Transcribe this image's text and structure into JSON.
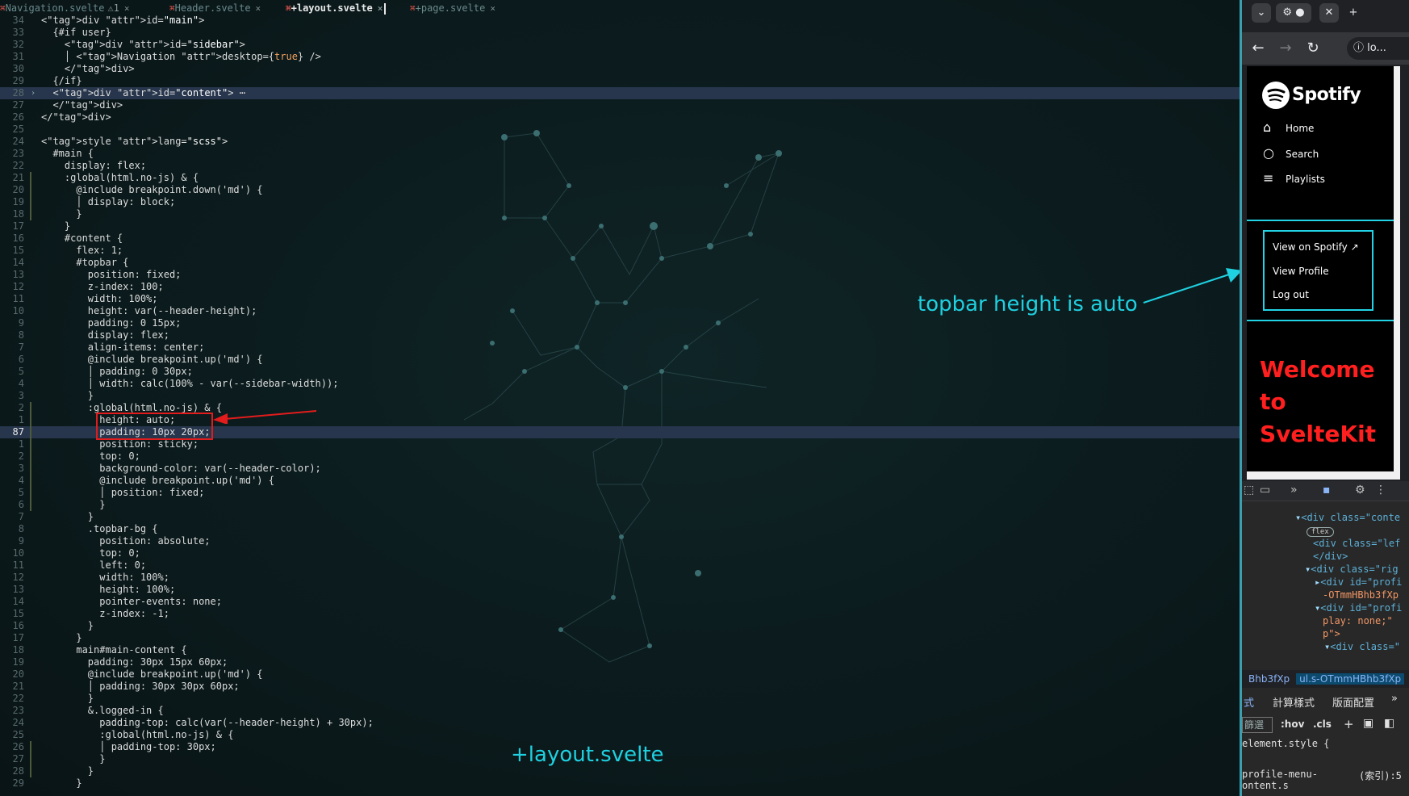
{
  "editor": {
    "tabs": [
      {
        "label": "Navigation.svelte",
        "warn": "⚠1",
        "close": "⨯"
      },
      {
        "label": "Header.svelte",
        "close": "⨯"
      },
      {
        "label": "+layout.svelte",
        "close": "⨯"
      },
      {
        "label": "+page.svelte",
        "close": "⨯"
      }
    ],
    "lines": [
      {
        "n": "34",
        "t": "<div id=\"main\">"
      },
      {
        "n": "33",
        "t": "  {#if user}"
      },
      {
        "n": "32",
        "t": "    <div id=\"sidebar\">"
      },
      {
        "n": "31",
        "t": "    │ <Navigation desktop={true} />"
      },
      {
        "n": "30",
        "t": "    </div>"
      },
      {
        "n": "29",
        "t": "  {/if}"
      },
      {
        "n": "28",
        "t": "  <div id=\"content\"> ⋯"
      },
      {
        "n": "27",
        "t": "  </div>"
      },
      {
        "n": "26",
        "t": "</div>"
      },
      {
        "n": "25",
        "t": ""
      },
      {
        "n": "24",
        "t": "<style lang=\"scss\">"
      },
      {
        "n": "23",
        "t": "  #main {"
      },
      {
        "n": "22",
        "t": "    display: flex;"
      },
      {
        "n": "21",
        "t": "    :global(html.no-js) & {"
      },
      {
        "n": "20",
        "t": "      @include breakpoint.down('md') {"
      },
      {
        "n": "19",
        "t": "      │ display: block;"
      },
      {
        "n": "18",
        "t": "      }"
      },
      {
        "n": "17",
        "t": "    }"
      },
      {
        "n": "16",
        "t": "    #content {"
      },
      {
        "n": "15",
        "t": "      flex: 1;"
      },
      {
        "n": "14",
        "t": "      #topbar {"
      },
      {
        "n": "13",
        "t": "        position: fixed;"
      },
      {
        "n": "12",
        "t": "        z-index: 100;"
      },
      {
        "n": "11",
        "t": "        width: 100%;"
      },
      {
        "n": "10",
        "t": "        height: var(--header-height);"
      },
      {
        "n": "9",
        "t": "        padding: 0 15px;"
      },
      {
        "n": "8",
        "t": "        display: flex;"
      },
      {
        "n": "7",
        "t": "        align-items: center;"
      },
      {
        "n": "6",
        "t": "        @include breakpoint.up('md') {"
      },
      {
        "n": "5",
        "t": "        │ padding: 0 30px;"
      },
      {
        "n": "4",
        "t": "        │ width: calc(100% - var(--sidebar-width));"
      },
      {
        "n": "3",
        "t": "        }"
      },
      {
        "n": "2",
        "t": "        :global(html.no-js) & {"
      },
      {
        "n": "1",
        "t": "          height: auto;"
      },
      {
        "n": "87",
        "t": "          padding: 10px 20px;"
      },
      {
        "n": "1",
        "t": "          position: sticky;"
      },
      {
        "n": "2",
        "t": "          top: 0;"
      },
      {
        "n": "3",
        "t": "          background-color: var(--header-color);"
      },
      {
        "n": "4",
        "t": "          @include breakpoint.up('md') {"
      },
      {
        "n": "5",
        "t": "          │ position: fixed;"
      },
      {
        "n": "6",
        "t": "          }"
      },
      {
        "n": "7",
        "t": "        }"
      },
      {
        "n": "8",
        "t": "        .topbar-bg {"
      },
      {
        "n": "9",
        "t": "          position: absolute;"
      },
      {
        "n": "10",
        "t": "          top: 0;"
      },
      {
        "n": "11",
        "t": "          left: 0;"
      },
      {
        "n": "12",
        "t": "          width: 100%;"
      },
      {
        "n": "13",
        "t": "          height: 100%;"
      },
      {
        "n": "14",
        "t": "          pointer-events: none;"
      },
      {
        "n": "15",
        "t": "          z-index: -1;"
      },
      {
        "n": "16",
        "t": "        }"
      },
      {
        "n": "17",
        "t": "      }"
      },
      {
        "n": "18",
        "t": "      main#main-content {"
      },
      {
        "n": "19",
        "t": "        padding: 30px 15px 60px;"
      },
      {
        "n": "20",
        "t": "        @include breakpoint.up('md') {"
      },
      {
        "n": "21",
        "t": "        │ padding: 30px 30px 60px;"
      },
      {
        "n": "22",
        "t": "        }"
      },
      {
        "n": "23",
        "t": "        &.logged-in {"
      },
      {
        "n": "24",
        "t": "          padding-top: calc(var(--header-height) + 30px);"
      },
      {
        "n": "25",
        "t": "          :global(html.no-js) & {"
      },
      {
        "n": "26",
        "t": "          │ padding-top: 30px;"
      },
      {
        "n": "27",
        "t": "          }"
      },
      {
        "n": "28",
        "t": "        }"
      },
      {
        "n": "29",
        "t": "      }"
      }
    ],
    "highlighted_line_indexes": [
      6,
      34
    ],
    "annotation_topbar": "topbar height is auto",
    "annotation_layout": "+layout.svelte"
  },
  "browser": {
    "url": "lo...",
    "page": {
      "logo": "Spotify",
      "nav": [
        {
          "label": "Home",
          "icon": "home-icon"
        },
        {
          "label": "Search",
          "icon": "search-icon"
        },
        {
          "label": "Playlists",
          "icon": "playlist-icon"
        }
      ],
      "profile_menu": [
        "View on Spotify",
        "View Profile",
        "Log out"
      ],
      "welcome": [
        "Welcome",
        "to",
        "SvelteKit"
      ]
    },
    "devtools": {
      "dom": [
        "<div class=\"conte",
        "flex",
        "<div class=\"lef",
        "</div>",
        "<div class=\"rig",
        "<div id=\"profi",
        "-OTmmHBhb3fXp",
        "<div id=\"profi",
        "play: none;\"",
        "p\">",
        "<div class=\""
      ],
      "crumbs": [
        "Bhb3fXp",
        "ul.s-OTmmHBhb3fXp"
      ],
      "style_tabs": [
        "式",
        "計算樣式",
        "版面配置"
      ],
      "filter": [
        "篩選",
        ":hov",
        ".cls"
      ],
      "element_style": "element.style {",
      "rule": "profile-menu-",
      "rule_source": "(索引):5",
      "rule_cont": "ontent.s"
    }
  }
}
